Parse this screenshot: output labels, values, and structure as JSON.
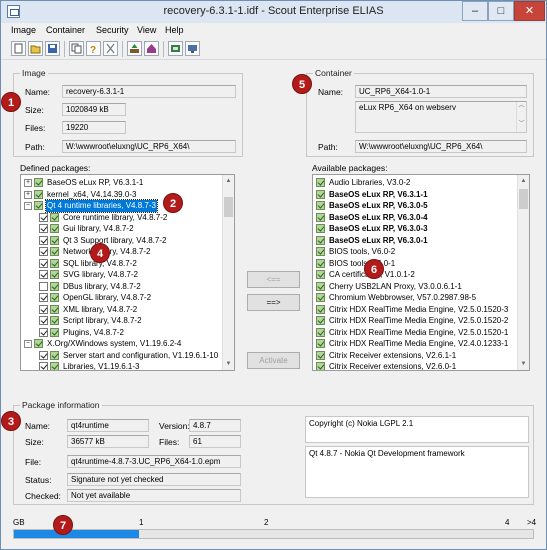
{
  "window": {
    "title": "recovery-6.3.1-1.idf - Scout Enterprise ELIAS",
    "min": "–",
    "max": "□",
    "close": "✕"
  },
  "menu": [
    "Image",
    "Container",
    "Security",
    "View",
    "Help"
  ],
  "toolbar": {
    "icons": [
      "new-icon",
      "open-icon",
      "save-icon",
      "copy-icon",
      "help-icon",
      "cut-icon",
      "upload-icon",
      "home-icon",
      "properties-icon",
      "settings-icon"
    ]
  },
  "image": {
    "group_label": "Image",
    "name_label": "Name:",
    "name": "recovery-6.3.1-1",
    "size_label": "Size:",
    "size": "1020849 kB",
    "files_label": "Files:",
    "files": "19220",
    "path_label": "Path:",
    "path": "W:\\wwwroot\\eluxng\\UC_RP6_X64\\"
  },
  "container": {
    "group_label": "Container",
    "name_label": "Name:",
    "name": "UC_RP6_X64-1.0-1",
    "description": "eLux RP6_X64 on webserv",
    "path_label": "Path:",
    "path": "W:\\wwwroot\\eluxng\\UC_RP6_X64\\"
  },
  "defined": {
    "label": "Defined packages:",
    "rows": [
      {
        "text": "BaseOS eLux RP, V6.3.1-1",
        "exp": "+",
        "lvl": 0,
        "sel": false
      },
      {
        "text": "kernel_x64, V4.14.39.0-3",
        "exp": "+",
        "lvl": 0,
        "sel": false
      },
      {
        "text": "Qt 4 runtime libraries, V4.8.7-3",
        "exp": "−",
        "lvl": 0,
        "sel": true
      },
      {
        "text": "Core runtime library, V4.8.7-2",
        "exp": "",
        "lvl": 1,
        "cb": true,
        "sel": false
      },
      {
        "text": "Gui library, V4.8.7-2",
        "exp": "",
        "lvl": 1,
        "cb": true,
        "sel": false
      },
      {
        "text": "Qt 3 Support library, V4.8.7-2",
        "exp": "",
        "lvl": 1,
        "cb": true,
        "sel": false
      },
      {
        "text": "Network library, V4.8.7-2",
        "exp": "",
        "lvl": 1,
        "cb": true,
        "sel": false
      },
      {
        "text": "SQL library, V4.8.7-2",
        "exp": "",
        "lvl": 1,
        "cb": true,
        "sel": false
      },
      {
        "text": "SVG library, V4.8.7-2",
        "exp": "",
        "lvl": 1,
        "cb": true,
        "sel": false
      },
      {
        "text": "DBus library, V4.8.7-2",
        "exp": "",
        "lvl": 1,
        "cb": false,
        "sel": false
      },
      {
        "text": "OpenGL library, V4.8.7-2",
        "exp": "",
        "lvl": 1,
        "cb": true,
        "sel": false
      },
      {
        "text": "XML library, V4.8.7-2",
        "exp": "",
        "lvl": 1,
        "cb": true,
        "sel": false
      },
      {
        "text": "Script library, V4.8.7-2",
        "exp": "",
        "lvl": 1,
        "cb": true,
        "sel": false
      },
      {
        "text": "Plugins, V4.8.7-2",
        "exp": "",
        "lvl": 1,
        "cb": true,
        "sel": false
      },
      {
        "text": "X.Org/XWindows system, V1.19.6.2-4",
        "exp": "−",
        "lvl": 0,
        "sel": false
      },
      {
        "text": "Server start and configuration, V1.19.6.1-10",
        "exp": "",
        "lvl": 1,
        "cb": true,
        "sel": false
      },
      {
        "text": "Libraries, V1.19.6.1-3",
        "exp": "",
        "lvl": 1,
        "cb": true,
        "sel": false
      }
    ]
  },
  "available": {
    "label": "Available packages:",
    "rows": [
      {
        "text": "Audio Libraries, V3.0-2",
        "bold": false
      },
      {
        "text": "BaseOS eLux RP, V6.3.1-1",
        "bold": true
      },
      {
        "text": "BaseOS eLux RP, V6.3.0-5",
        "bold": true
      },
      {
        "text": "BaseOS eLux RP, V6.3.0-4",
        "bold": true
      },
      {
        "text": "BaseOS eLux RP, V6.3.0-3",
        "bold": true
      },
      {
        "text": "BaseOS eLux RP, V6.3.0-1",
        "bold": true
      },
      {
        "text": "BIOS tools, V6.0-2",
        "bold": false
      },
      {
        "text": "BIOS tools, V6.0-1",
        "bold": false
      },
      {
        "text": "CA certificates, V1.0.1-2",
        "bold": false
      },
      {
        "text": "Cherry USB2LAN Proxy, V3.0.0.6.1-1",
        "bold": false
      },
      {
        "text": "Chromium Webbrowser, V57.0.2987.98-5",
        "bold": false
      },
      {
        "text": "Citrix HDX RealTime Media Engine, V2.5.0.1520-3",
        "bold": false
      },
      {
        "text": "Citrix HDX RealTime Media Engine, V2.5.0.1520-2",
        "bold": false
      },
      {
        "text": "Citrix HDX RealTime Media Engine, V2.5.0.1520-1",
        "bold": false
      },
      {
        "text": "Citrix HDX RealTime Media Engine, V2.4.0.1233-1",
        "bold": false
      },
      {
        "text": "Citrix Receiver extensions, V2.6.1-1",
        "bold": false
      },
      {
        "text": "Citrix Receiver extensions, V2.6.0-1",
        "bold": false
      }
    ]
  },
  "buttons": {
    "remove": "<==",
    "add": "==>",
    "activate": "Activate"
  },
  "pkginfo": {
    "group_label": "Package information",
    "name_label": "Name:",
    "name": "qt4runtime",
    "version_label": "Version:",
    "version": "4.8.7",
    "size_label": "Size:",
    "size": "36577 kB",
    "files_label": "Files:",
    "files": "61",
    "file_label": "File:",
    "file": "qt4runtime-4.8.7-3.UC_RP6_X64-1.0.epm",
    "status_label": "Status:",
    "status": "Signature not yet checked",
    "checked_label": "Checked:",
    "checked": "Not yet available",
    "license": "Copyright (c) Nokia LGPL 2.1",
    "description": "Qt 4.8.7 - Nokia Qt Development framework"
  },
  "status": {
    "unit": "GB",
    "ticks": [
      "1",
      "2",
      "4",
      ">4"
    ],
    "usage_fraction": 0.24
  },
  "badges": [
    "1",
    "2",
    "3",
    "4",
    "5",
    "6",
    "7"
  ],
  "colors": {
    "selection": "#0078d7",
    "progress": "#1e88e5",
    "badge": "#b31b1b"
  }
}
